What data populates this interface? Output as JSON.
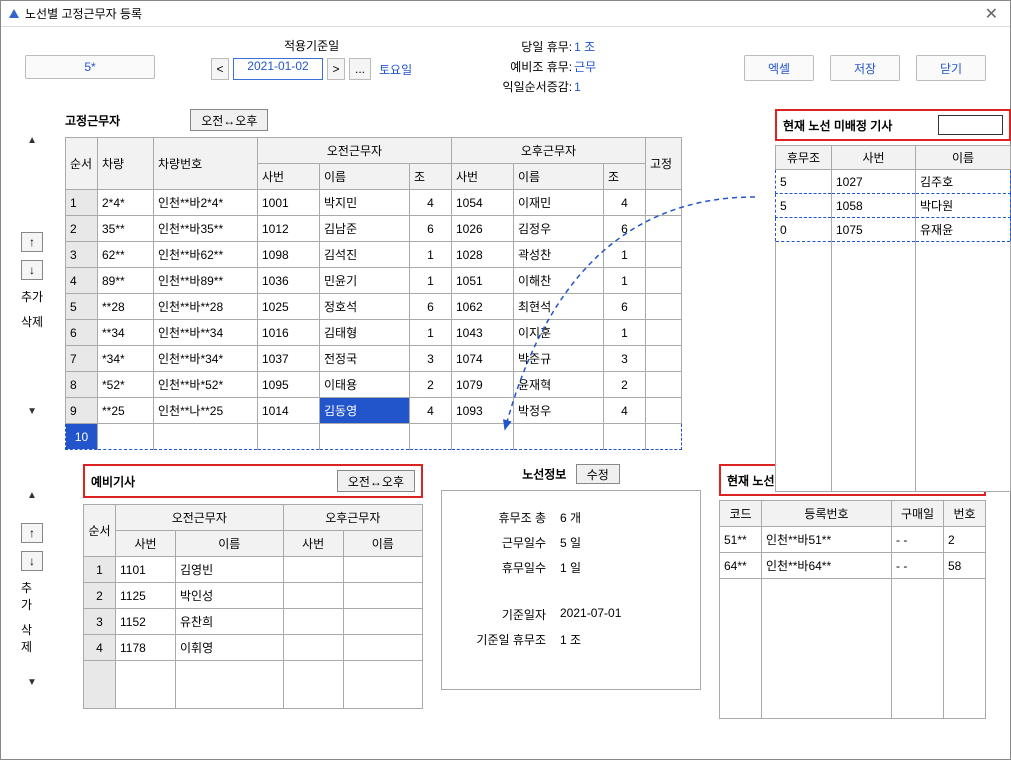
{
  "window": {
    "title": "노선별 고정근무자 등록"
  },
  "toolbar": {
    "route": "5*",
    "date_label": "적용기준일",
    "date": "2021-01-02",
    "dow": "토요일"
  },
  "info": {
    "l1a": "당일 휴무:",
    "l1b": "1 조",
    "l2a": "예비조 휴무:",
    "l2b": "근무",
    "l3a": "익일순서증감:",
    "l3b": "1"
  },
  "buttons": {
    "excel": "엑셀",
    "save": "저장",
    "close": "닫기"
  },
  "fixed": {
    "title": "고정근무자",
    "swap": "오전↔오후",
    "headers": {
      "seq": "순서",
      "veh": "차량",
      "vehno": "차량번호",
      "morning": "오전근무자",
      "afternoon": "오후근무자",
      "fixed": "고정",
      "emp": "사번",
      "name": "이름",
      "group": "조"
    },
    "rows": [
      {
        "n": "1",
        "v": "2*4*",
        "vn": "인천**바2*4*",
        "me": "1001",
        "mn": "박지민",
        "mg": "4",
        "ae": "1054",
        "an": "이재민",
        "ag": "4"
      },
      {
        "n": "2",
        "v": "35**",
        "vn": "인천**바35**",
        "me": "1012",
        "mn": "김남준",
        "mg": "6",
        "ae": "1026",
        "an": "김정우",
        "ag": "6"
      },
      {
        "n": "3",
        "v": "62**",
        "vn": "인천**바62**",
        "me": "1098",
        "mn": "김석진",
        "mg": "1",
        "ae": "1028",
        "an": "곽성찬",
        "ag": "1"
      },
      {
        "n": "4",
        "v": "89**",
        "vn": "인천**바89**",
        "me": "1036",
        "mn": "민윤기",
        "mg": "1",
        "ae": "1051",
        "an": "이해찬",
        "ag": "1"
      },
      {
        "n": "5",
        "v": "**28",
        "vn": "인천**바**28",
        "me": "1025",
        "mn": "정호석",
        "mg": "6",
        "ae": "1062",
        "an": "최현석",
        "ag": "6"
      },
      {
        "n": "6",
        "v": "**34",
        "vn": "인천**바**34",
        "me": "1016",
        "mn": "김태형",
        "mg": "1",
        "ae": "1043",
        "an": "이지훈",
        "ag": "1"
      },
      {
        "n": "7",
        "v": "*34*",
        "vn": "인천**바*34*",
        "me": "1037",
        "mn": "전정국",
        "mg": "3",
        "ae": "1074",
        "an": "박준규",
        "ag": "3"
      },
      {
        "n": "8",
        "v": "*52*",
        "vn": "인천**바*52*",
        "me": "1095",
        "mn": "이태용",
        "mg": "2",
        "ae": "1079",
        "an": "윤재혁",
        "ag": "2"
      },
      {
        "n": "9",
        "v": "**25",
        "vn": "인천**나**25",
        "me": "1014",
        "mn": "김동영",
        "mg": "4",
        "ae": "1093",
        "an": "박정우",
        "ag": "4"
      }
    ],
    "empty_row": "10"
  },
  "side": {
    "add": "추가",
    "del": "삭제"
  },
  "reserve": {
    "title": "예비기사",
    "swap": "오전↔오후",
    "headers": {
      "seq": "순서",
      "morning": "오전근무자",
      "afternoon": "오후근무자",
      "emp": "사번",
      "name": "이름"
    },
    "rows": [
      {
        "n": "1",
        "me": "1101",
        "mn": "김영빈",
        "ae": "",
        "an": ""
      },
      {
        "n": "2",
        "me": "1125",
        "mn": "박인성",
        "ae": "",
        "an": ""
      },
      {
        "n": "3",
        "me": "1152",
        "mn": "유찬희",
        "ae": "",
        "an": ""
      },
      {
        "n": "4",
        "me": "1178",
        "mn": "이휘영",
        "ae": "",
        "an": ""
      }
    ]
  },
  "routeinfo": {
    "title": "노선정보",
    "edit": "수정",
    "l1a": "휴무조 총",
    "l1b": "6 개",
    "l2a": "근무일수",
    "l2b": "5 일",
    "l3a": "휴무일수",
    "l3b": "1 일",
    "l4a": "기준일자",
    "l4b": "2021-07-01",
    "l5a": "기준일 휴무조",
    "l5b": "1 조"
  },
  "unassigned_drivers": {
    "title": "현재 노선 미배정 기사",
    "headers": {
      "hg": "휴무조",
      "emp": "사번",
      "name": "이름"
    },
    "rows": [
      {
        "hg": "5",
        "emp": "1027",
        "name": "김주호"
      },
      {
        "hg": "5",
        "emp": "1058",
        "name": "박다원"
      },
      {
        "hg": "0",
        "emp": "1075",
        "name": "유재윤"
      }
    ]
  },
  "unassigned_vehicles": {
    "title": "현재 노선 미배정 차량",
    "headers": {
      "code": "코드",
      "regno": "등록번호",
      "buydate": "구매일",
      "no": "번호"
    },
    "rows": [
      {
        "code": "51**",
        "regno": "인천**바51**",
        "buydate": "- -",
        "no": "2"
      },
      {
        "code": "64**",
        "regno": "인천**바64**",
        "buydate": "- -",
        "no": "58"
      }
    ]
  }
}
